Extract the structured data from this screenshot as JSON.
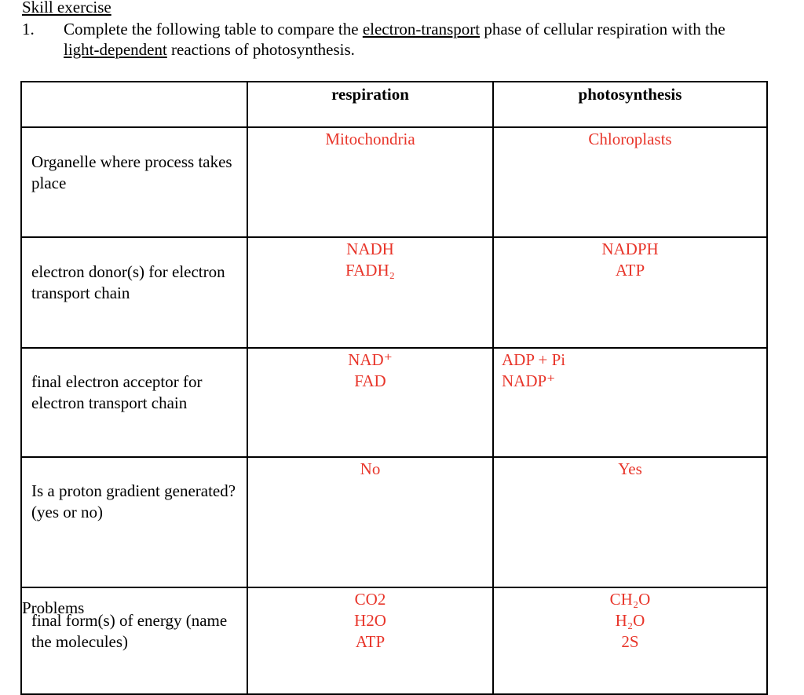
{
  "section_heading": "Skill exercise",
  "question": {
    "number": "1.",
    "parts": [
      {
        "text": "Complete the following table to compare the ",
        "underline": false
      },
      {
        "text": "electron-transport",
        "underline": true
      },
      {
        "text": " phase of cellular respiration with the ",
        "underline": false
      },
      {
        "text": "light-dependent",
        "underline": true
      },
      {
        "text": " reactions of photosynthesis.",
        "underline": false
      }
    ]
  },
  "table": {
    "headers": [
      "",
      "respiration",
      "photosynthesis"
    ],
    "rows": [
      {
        "label": "Organelle where process takes place",
        "respiration": [
          "Mitochondria"
        ],
        "photosynthesis": [
          "Chloroplasts"
        ]
      },
      {
        "label": "electron donor(s) for electron transport chain",
        "respiration": [
          "NADH",
          "FADH₂"
        ],
        "photosynthesis": [
          "NADPH",
          "ATP"
        ]
      },
      {
        "label": "final electron acceptor for electron transport chain",
        "respiration": [
          "NAD⁺",
          "FAD"
        ],
        "photosynthesis": [
          "ADP + Pi",
          "NADP⁺"
        ]
      },
      {
        "label": "Is a proton gradient generated? (yes or no)",
        "respiration": [
          "No"
        ],
        "photosynthesis": [
          "Yes"
        ]
      },
      {
        "label": "final form(s) of energy (name the molecules)",
        "respiration": [
          "CO2",
          "H2O",
          "ATP"
        ],
        "photosynthesis": [
          "CH₂O",
          "H₂O",
          "2S"
        ]
      }
    ]
  },
  "footer_heading": "Problems",
  "colors": {
    "answer_text": "#e8352a",
    "body_text": "#000000"
  }
}
